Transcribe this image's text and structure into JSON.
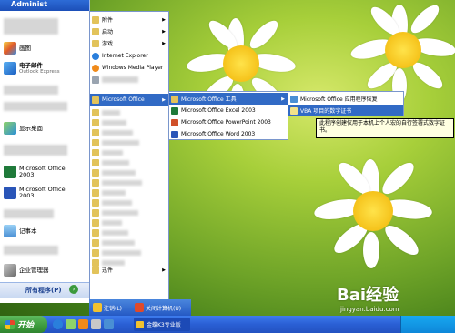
{
  "start_menu": {
    "username": "Administ",
    "pinned": [
      {
        "icon": "paint-icon",
        "label": "画图",
        "sub": ""
      },
      {
        "icon": "outlook-express-icon",
        "label": "电子邮件",
        "sub": "Outlook Express"
      },
      {
        "icon": "show-desktop-icon",
        "label": "显示桌面",
        "sub": ""
      },
      {
        "icon": "excel-icon",
        "label": "Microsoft Office",
        "sub": "2003"
      },
      {
        "icon": "word-icon",
        "label": "Microsoft Office",
        "sub": "2003"
      },
      {
        "icon": "notepad-icon",
        "label": "记事本",
        "sub": ""
      },
      {
        "icon": "enterprise-manager-icon",
        "label": "企业管理器",
        "sub": ""
      }
    ],
    "all_programs_label": "所有程序(P)"
  },
  "programs_menu": {
    "items": [
      {
        "label": "附件",
        "arrow": true,
        "blurred": false
      },
      {
        "label": "启动",
        "arrow": true,
        "blurred": false
      },
      {
        "label": "游戏",
        "arrow": true,
        "blurred": false
      },
      {
        "label": "Internet Explorer",
        "arrow": false,
        "blurred": false
      },
      {
        "label": "Windows Media Player",
        "arrow": false,
        "blurred": false
      },
      {
        "label": "",
        "arrow": false,
        "blurred": true
      },
      {
        "label": "Microsoft Office",
        "arrow": true,
        "blurred": false,
        "highlight": true
      }
    ],
    "blurred_rows": 16,
    "bottom_label": "迅件"
  },
  "office_menu": {
    "items": [
      {
        "label": "Microsoft Office 工具",
        "icon": "office-tools-icon",
        "arrow": true,
        "highlight": true
      },
      {
        "label": "Microsoft Office Excel 2003",
        "icon": "excel-icon",
        "arrow": false,
        "highlight": false
      },
      {
        "label": "Microsoft Office PowerPoint 2003",
        "icon": "powerpoint-icon",
        "arrow": false,
        "highlight": false
      },
      {
        "label": "Microsoft Office Word 2003",
        "icon": "word-icon",
        "arrow": false,
        "highlight": false
      }
    ]
  },
  "tools_menu": {
    "items": [
      {
        "label": "Microsoft Office 应用程序恢复",
        "highlight": false
      },
      {
        "label": "VBA 项目的数字证书",
        "highlight": true
      }
    ]
  },
  "tooltip": {
    "text": "此程序创建仅用于本机上个人宏的自行签署式数字证书。"
  },
  "logoff_bar": {
    "logoff_label": "注销(L)",
    "shutdown_label": "关闭计算机(U)"
  },
  "taskbar": {
    "start_label": "开始",
    "window_label": "金蝶K3专业版"
  },
  "watermark": {
    "brand": "Bai经验",
    "url": "jingyan.baidu.com"
  },
  "colors": {
    "xp_blue": "#2a5fd4",
    "highlight": "#316ac5",
    "start_green": "#3c9a3c",
    "tooltip_bg": "#ffffe1"
  }
}
